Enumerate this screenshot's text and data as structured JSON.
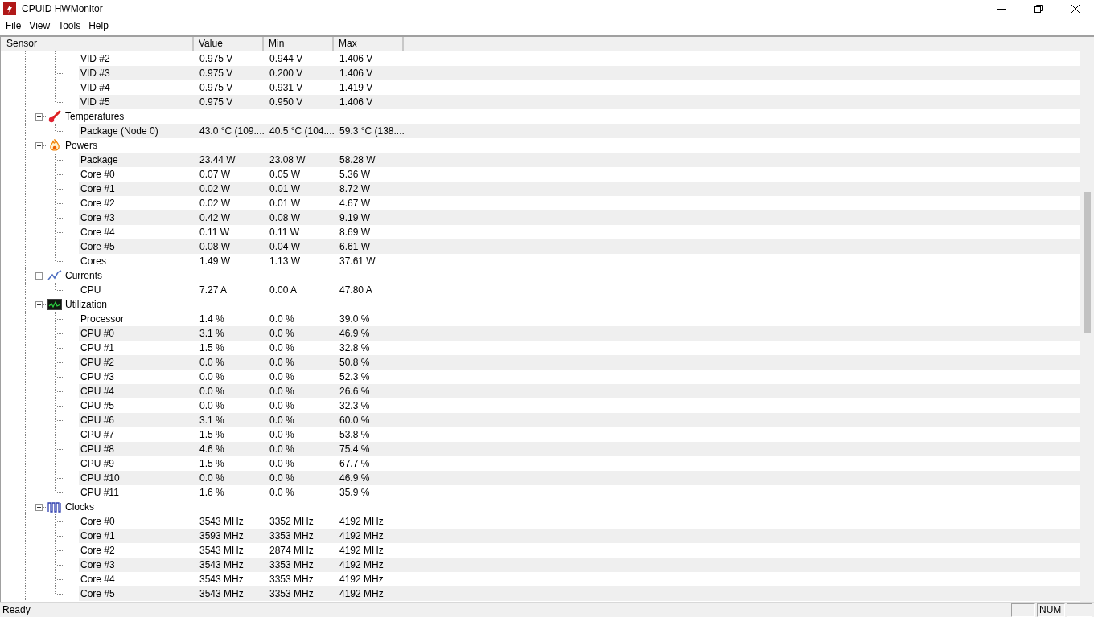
{
  "window": {
    "title": "CPUID HWMonitor"
  },
  "menu": [
    "File",
    "View",
    "Tools",
    "Help"
  ],
  "columns": [
    "Sensor",
    "Value",
    "Min",
    "Max"
  ],
  "tree": [
    {
      "children": [
        {
          "name": "VID #2",
          "value": "0.975 V",
          "min": "0.944 V",
          "max": "1.406 V"
        },
        {
          "name": "VID #3",
          "value": "0.975 V",
          "min": "0.200 V",
          "max": "1.406 V"
        },
        {
          "name": "VID #4",
          "value": "0.975 V",
          "min": "0.931 V",
          "max": "1.419 V"
        },
        {
          "name": "VID #5",
          "value": "0.975 V",
          "min": "0.950 V",
          "max": "1.406 V"
        }
      ]
    },
    {
      "kind": "temperature",
      "label": "Temperatures",
      "expanded": true,
      "children": [
        {
          "name": "Package (Node 0)",
          "value": "43.0 °C  (109....",
          "min": "40.5 °C  (104....",
          "max": "59.3 °C  (138...."
        }
      ]
    },
    {
      "kind": "power",
      "label": "Powers",
      "expanded": true,
      "children": [
        {
          "name": "Package",
          "value": "23.44 W",
          "min": "23.08 W",
          "max": "58.28 W"
        },
        {
          "name": "Core #0",
          "value": "0.07 W",
          "min": "0.05 W",
          "max": "5.36 W"
        },
        {
          "name": "Core #1",
          "value": "0.02 W",
          "min": "0.01 W",
          "max": "8.72 W"
        },
        {
          "name": "Core #2",
          "value": "0.02 W",
          "min": "0.01 W",
          "max": "4.67 W"
        },
        {
          "name": "Core #3",
          "value": "0.42 W",
          "min": "0.08 W",
          "max": "9.19 W"
        },
        {
          "name": "Core #4",
          "value": "0.11 W",
          "min": "0.11 W",
          "max": "8.69 W"
        },
        {
          "name": "Core #5",
          "value": "0.08 W",
          "min": "0.04 W",
          "max": "6.61 W"
        },
        {
          "name": "Cores",
          "value": "1.49 W",
          "min": "1.13 W",
          "max": "37.61 W"
        }
      ]
    },
    {
      "kind": "current",
      "label": "Currents",
      "expanded": true,
      "children": [
        {
          "name": "CPU",
          "value": "7.27 A",
          "min": "0.00 A",
          "max": "47.80 A"
        }
      ]
    },
    {
      "kind": "utilization",
      "label": "Utilization",
      "expanded": true,
      "children": [
        {
          "name": "Processor",
          "value": "1.4 %",
          "min": "0.0 %",
          "max": "39.0 %"
        },
        {
          "name": "CPU #0",
          "value": "3.1 %",
          "min": "0.0 %",
          "max": "46.9 %"
        },
        {
          "name": "CPU #1",
          "value": "1.5 %",
          "min": "0.0 %",
          "max": "32.8 %"
        },
        {
          "name": "CPU #2",
          "value": "0.0 %",
          "min": "0.0 %",
          "max": "50.8 %"
        },
        {
          "name": "CPU #3",
          "value": "0.0 %",
          "min": "0.0 %",
          "max": "52.3 %"
        },
        {
          "name": "CPU #4",
          "value": "0.0 %",
          "min": "0.0 %",
          "max": "26.6 %"
        },
        {
          "name": "CPU #5",
          "value": "0.0 %",
          "min": "0.0 %",
          "max": "32.3 %"
        },
        {
          "name": "CPU #6",
          "value": "3.1 %",
          "min": "0.0 %",
          "max": "60.0 %"
        },
        {
          "name": "CPU #7",
          "value": "1.5 %",
          "min": "0.0 %",
          "max": "53.8 %"
        },
        {
          "name": "CPU #8",
          "value": "4.6 %",
          "min": "0.0 %",
          "max": "75.4 %"
        },
        {
          "name": "CPU #9",
          "value": "1.5 %",
          "min": "0.0 %",
          "max": "67.7 %"
        },
        {
          "name": "CPU #10",
          "value": "0.0 %",
          "min": "0.0 %",
          "max": "46.9 %"
        },
        {
          "name": "CPU #11",
          "value": "1.6 %",
          "min": "0.0 %",
          "max": "35.9 %"
        }
      ]
    },
    {
      "kind": "clock",
      "label": "Clocks",
      "expanded": true,
      "children": [
        {
          "name": "Core #0",
          "value": "3543 MHz",
          "min": "3352 MHz",
          "max": "4192 MHz"
        },
        {
          "name": "Core #1",
          "value": "3593 MHz",
          "min": "3353 MHz",
          "max": "4192 MHz"
        },
        {
          "name": "Core #2",
          "value": "3543 MHz",
          "min": "2874 MHz",
          "max": "4192 MHz"
        },
        {
          "name": "Core #3",
          "value": "3543 MHz",
          "min": "3353 MHz",
          "max": "4192 MHz"
        },
        {
          "name": "Core #4",
          "value": "3543 MHz",
          "min": "3353 MHz",
          "max": "4192 MHz"
        },
        {
          "name": "Core #5",
          "value": "3543 MHz",
          "min": "3353 MHz",
          "max": "4192 MHz"
        }
      ]
    }
  ],
  "status_bar": {
    "message": "Ready",
    "indicator": "NUM"
  }
}
